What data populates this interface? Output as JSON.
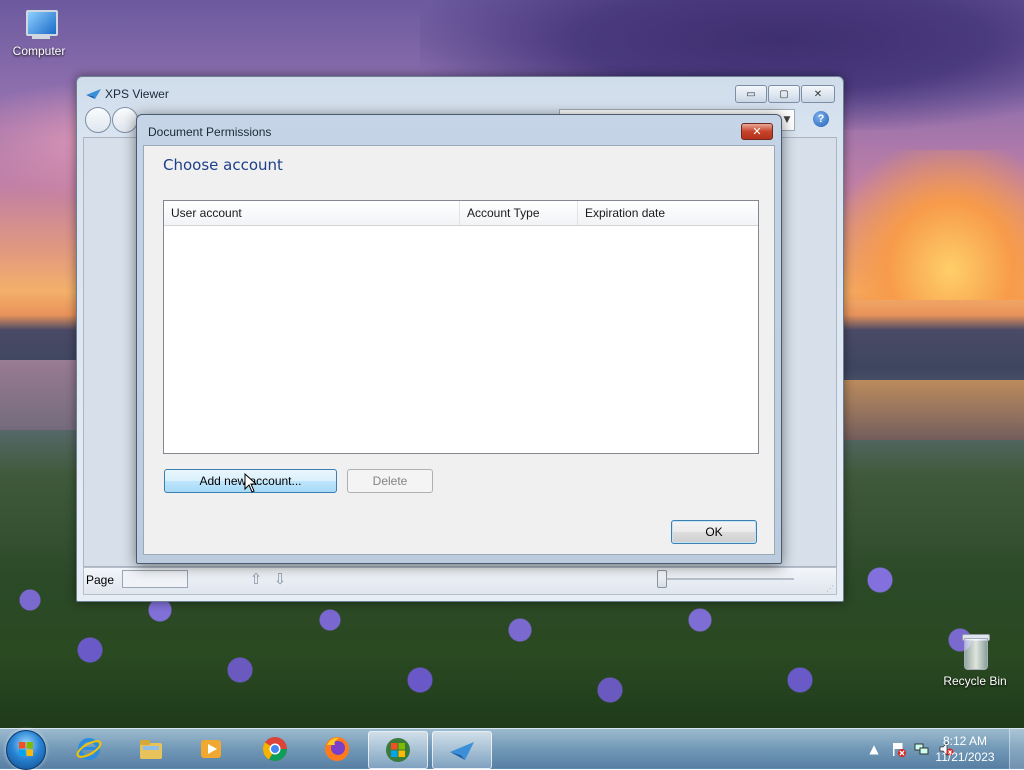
{
  "desktop": {
    "icons": [
      {
        "label": "Computer"
      },
      {
        "label": "Recycle Bin"
      }
    ]
  },
  "xps_window": {
    "title": "XPS Viewer",
    "caption_buttons": {
      "minimize": "▭",
      "maximize": "▢",
      "close": "✕"
    },
    "help_glyph": "?",
    "search_dropdown_glyph": "▼",
    "status_bar": {
      "page_label": "Page",
      "page_value": "",
      "prev_glyph": "⇧",
      "next_glyph": "⇩"
    }
  },
  "dialog": {
    "title": "Document Permissions",
    "close_glyph": "✕",
    "heading": "Choose account",
    "list": {
      "columns": [
        "User account",
        "Account Type",
        "Expiration date"
      ],
      "rows": []
    },
    "buttons": {
      "add_new_account": "Add new account...",
      "delete": "Delete",
      "ok": "OK"
    }
  },
  "taskbar": {
    "apps": [
      {
        "name": "Internet Explorer",
        "icon": "ie-icon"
      },
      {
        "name": "Windows Explorer",
        "icon": "folder-icon"
      },
      {
        "name": "Windows Media Player",
        "icon": "media-player-icon"
      },
      {
        "name": "Google Chrome",
        "icon": "chrome-icon"
      },
      {
        "name": "Firefox",
        "icon": "firefox-icon"
      },
      {
        "name": "Windows",
        "icon": "windows-icon"
      },
      {
        "name": "XPS Viewer",
        "icon": "xps-viewer-icon"
      }
    ],
    "tray": {
      "expand_glyph": "▲"
    },
    "clock": {
      "time": "8:12 AM",
      "date": "11/21/2023"
    }
  },
  "colors": {
    "heading_blue": "#1e3f8a",
    "close_red": "#c7432a",
    "hover_blue": "#bee6fd"
  }
}
